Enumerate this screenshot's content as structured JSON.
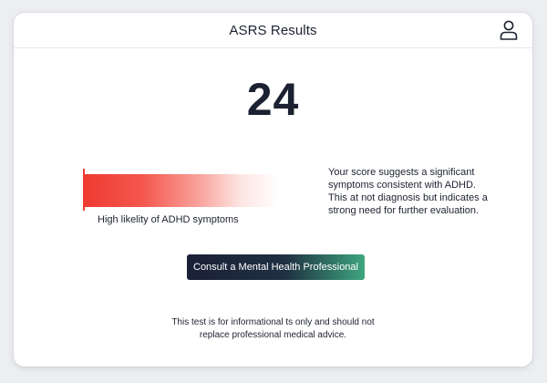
{
  "header": {
    "title": "ASRS Results",
    "profile_icon": "user-icon"
  },
  "result": {
    "score": "24",
    "level_fraction": 0.82,
    "level_label": "High likelity of ADHD symptoms",
    "meter_color": "#ef3b32",
    "explanation_lines": [
      "Your score suggests a significant",
      "symptoms consistent with ADHD.",
      "This at not diagnosis but indicates a",
      "strong need for further evaluation."
    ]
  },
  "cta": {
    "label": "Consult a Mental Health Professional"
  },
  "disclaimer": {
    "lines": [
      "This test is for informational ts only and should not",
      "replace professional medical advice."
    ]
  }
}
